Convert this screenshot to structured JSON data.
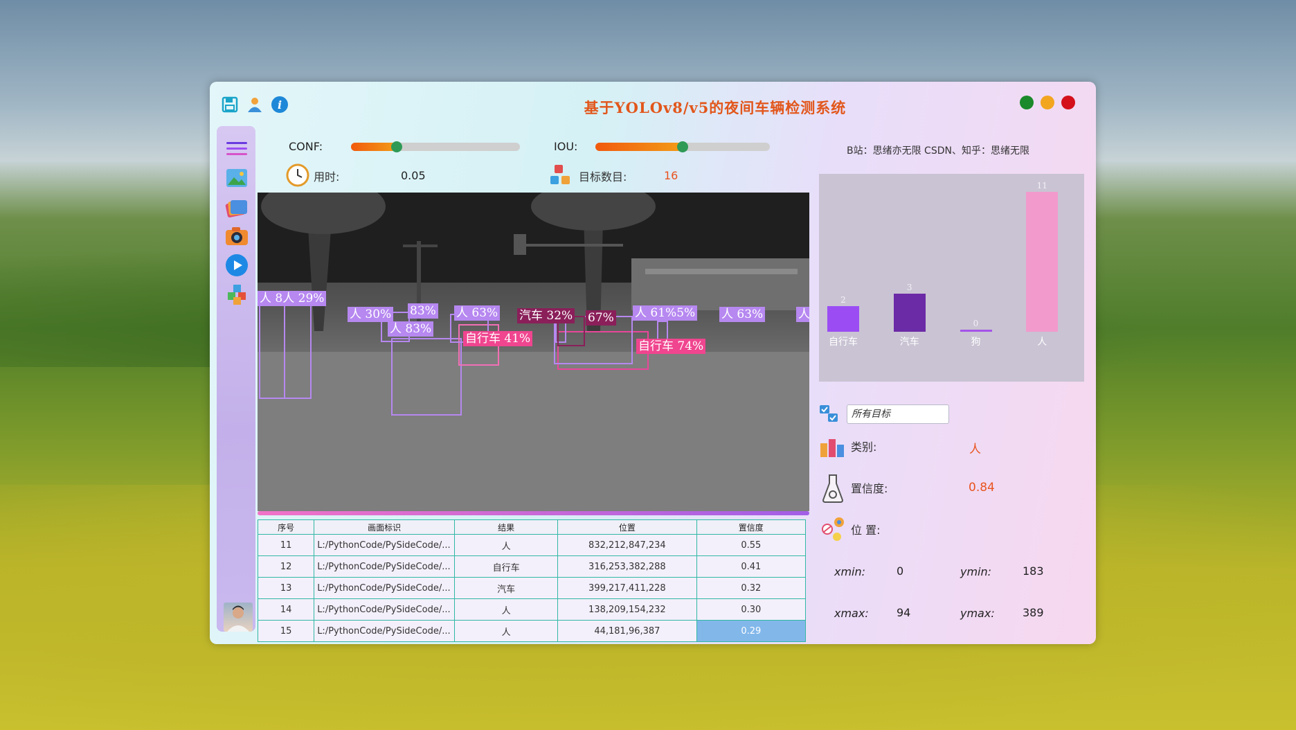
{
  "window": {
    "title": "基于YOLOv8/v5的夜间车辆检测系统"
  },
  "controls": {
    "conf_label": "CONF:",
    "conf_value_fraction": 0.27,
    "iou_label": "IOU:",
    "iou_value_fraction": 0.5,
    "time_label": "用时:",
    "time_value": "0.05",
    "count_label": "目标数目:",
    "count_value": "16"
  },
  "credits": "B站：思绪亦无限 CSDN、知乎：思绪无限",
  "detections_overlay": [
    "人 8人 29%",
    "人 30%",
    "83%",
    "人 83%",
    "人 63%",
    "汽车 32%",
    "67%",
    "自行车 41%",
    "人 61%5%",
    "自行车 74%",
    "人 63%",
    "人"
  ],
  "table": {
    "headers": [
      "序号",
      "画面标识",
      "结果",
      "位置",
      "置信度"
    ],
    "rows": [
      [
        "11",
        "L:/PythonCode/PySideCode/...",
        "人",
        "832,212,847,234",
        "0.55"
      ],
      [
        "12",
        "L:/PythonCode/PySideCode/...",
        "自行车",
        "316,253,382,288",
        "0.41"
      ],
      [
        "13",
        "L:/PythonCode/PySideCode/...",
        "汽车",
        "399,217,411,228",
        "0.32"
      ],
      [
        "14",
        "L:/PythonCode/PySideCode/...",
        "人",
        "138,209,154,232",
        "0.30"
      ],
      [
        "15",
        "L:/PythonCode/PySideCode/...",
        "人",
        "44,181,96,387",
        "0.29"
      ]
    ]
  },
  "chart_data": {
    "type": "bar",
    "categories": [
      "自行车",
      "汽车",
      "狗",
      "人"
    ],
    "values": [
      2,
      3,
      0,
      11
    ],
    "colors": [
      "#9b4df3",
      "#6b2aa6",
      "#a455e8",
      "#f39acd"
    ]
  },
  "detail": {
    "select_value": "所有目标",
    "class_label": "类别:",
    "class_value": "人",
    "conf_label": "置信度:",
    "conf_value": "0.84",
    "pos_label": "位 置:",
    "xmin_label": "xmin:",
    "xmin_value": "0",
    "ymin_label": "ymin:",
    "ymin_value": "183",
    "xmax_label": "xmax:",
    "xmax_value": "94",
    "ymax_label": "ymax:",
    "ymax_value": "389"
  },
  "icons": [
    "save-icon",
    "user-icon",
    "info-icon",
    "menu-icon",
    "image-icon",
    "folder-icon",
    "camera-icon",
    "play-icon",
    "cube-icon",
    "clock-icon",
    "dice-icon",
    "checkbox-icon",
    "bottles-icon",
    "flask-icon",
    "location-icon"
  ]
}
